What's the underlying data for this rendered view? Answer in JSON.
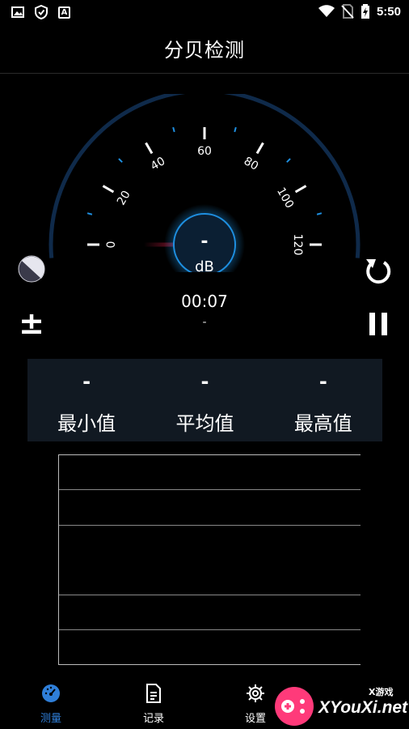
{
  "status_bar": {
    "time": "5:50",
    "icons": [
      "image-icon",
      "shield-icon",
      "a-icon",
      "wifi-icon",
      "no-sim-icon",
      "battery-icon"
    ],
    "left_letter": "A"
  },
  "header": {
    "title": "分贝检测"
  },
  "gauge": {
    "value_text": "-",
    "unit": "dB",
    "tick_labels": [
      "0",
      "20",
      "40",
      "60",
      "80",
      "100",
      "120"
    ],
    "min": 0,
    "max": 120,
    "needle_value": 0,
    "arc_color": "#0f2a4a",
    "needle_color": "#e0204a",
    "glow_color": "#1e8fe0"
  },
  "timer": {
    "elapsed": "00:07",
    "sub": "-"
  },
  "controls": {
    "left_top": "theme-toggle-icon",
    "left_bottom": "calibrate-plus-minus-icon",
    "right_top": "reset-icon",
    "right_bottom": "pause-icon",
    "calibrate_glyph": "±"
  },
  "stats": [
    {
      "value": "-",
      "label": "最小值"
    },
    {
      "value": "-",
      "label": "平均值"
    },
    {
      "value": "-",
      "label": "最高值"
    }
  ],
  "bottom_nav": [
    {
      "label": "测量",
      "icon": "speedometer-icon",
      "active": true
    },
    {
      "label": "记录",
      "icon": "document-icon",
      "active": false
    },
    {
      "label": "设置",
      "icon": "gear-icon",
      "active": false
    }
  ],
  "watermark": {
    "text": "XYouXi.net",
    "sub": "X游戏"
  },
  "colors": {
    "accent": "#2f7fd9",
    "panel": "#111922",
    "background": "#000000"
  }
}
